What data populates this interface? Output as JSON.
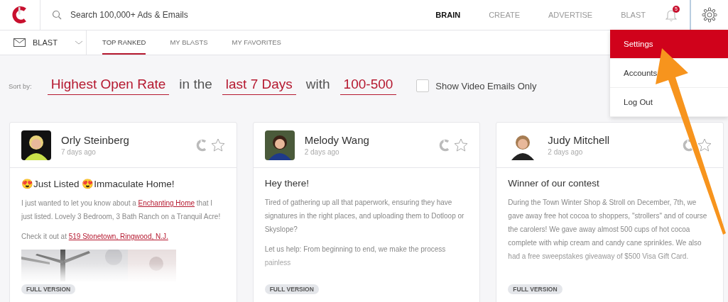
{
  "search": {
    "placeholder": "Search 100,000+ Ads & Emails"
  },
  "nav": [
    {
      "label": "BRAIN",
      "selected": true
    },
    {
      "label": "CREATE",
      "selected": false
    },
    {
      "label": "ADVERTISE",
      "selected": false
    },
    {
      "label": "BLAST",
      "selected": false
    }
  ],
  "notifications": {
    "count": "5"
  },
  "menu": [
    {
      "label": "Settings",
      "selected": true
    },
    {
      "label": "Accounts",
      "selected": false
    },
    {
      "label": "Log Out",
      "selected": false
    }
  ],
  "subnav": {
    "channel": "BLAST",
    "tabs": [
      {
        "label": "TOP RANKED",
        "selected": true
      },
      {
        "label": "MY BLASTS",
        "selected": false
      },
      {
        "label": "MY FAVORITES",
        "selected": false
      }
    ]
  },
  "sort": {
    "label": "Sort by:",
    "parts": [
      {
        "kind": "select",
        "text": "Highest Open Rate"
      },
      {
        "kind": "text",
        "text": "in the"
      },
      {
        "kind": "select",
        "text": "last 7 Days"
      },
      {
        "kind": "text",
        "text": "with"
      },
      {
        "kind": "select",
        "text": "100-500"
      }
    ],
    "video_only": {
      "label": "Show Video Emails Only",
      "checked": false
    }
  },
  "cards": [
    {
      "author": "Orly Steinberg",
      "time": "7 days ago",
      "title": "😍Just Listed 😍Immaculate Home!",
      "paragraphs": [
        [
          {
            "text": "I just wanted to let you know about a "
          },
          {
            "text": "Enchanting Home",
            "link": true
          },
          {
            "text": " that I just listed. Lovely 3 Bedroom, 3 Bath Ranch on a Tranquil Acre!"
          }
        ],
        [
          {
            "text": "Check it out at "
          },
          {
            "text": "519 Stonetown, Ringwood, N.J.",
            "link": true
          }
        ]
      ],
      "media": {
        "kind": "picture"
      },
      "badge": "FULL VERSION"
    },
    {
      "author": "Melody Wang",
      "time": "2 days ago",
      "title": "Hey there!",
      "paragraphs": [
        [
          {
            "text": "Tired of gathering up all that paperwork, ensuring they have signatures in the right places, and uploading them to Dotloop or Skyslope?"
          }
        ],
        [
          {
            "text": "Let us help: From beginning to end, we make the process painless"
          }
        ]
      ],
      "badge": "FULL VERSION"
    },
    {
      "author": "Judy Mitchell",
      "time": "2 days ago",
      "title": "Winner of our contest",
      "paragraphs": [
        [
          {
            "text": "During the Town Winter Shop & Stroll on December, 7th, we gave away free hot cocoa to shoppers, \"strollers\" and of course the carolers!  We gave away almost 500 cups of hot cocoa complete with whip cream and candy cane sprinkles. We also had a free sweepstakes giveaway of $500 Visa Gift Card."
          }
        ]
      ],
      "badge": "FULL VERSION"
    }
  ]
}
